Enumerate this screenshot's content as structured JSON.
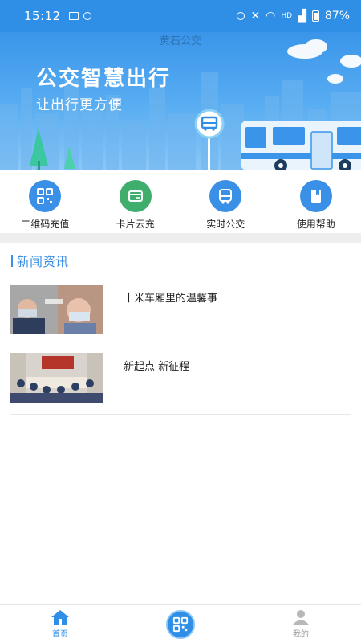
{
  "status_bar": {
    "time": "15:12",
    "network": "HD",
    "battery": "87%"
  },
  "banner": {
    "app_title": "黄石公交",
    "slogan_main": "公交智慧出行",
    "slogan_sub": "让出行更方便"
  },
  "quick_actions": [
    {
      "label": "二维码充值",
      "icon": "qr-code-icon",
      "color": "#3a8fe6"
    },
    {
      "label": "卡片云充",
      "icon": "card-icon",
      "color": "#3fae6c"
    },
    {
      "label": "实时公交",
      "icon": "bus-icon",
      "color": "#3a8fe6"
    },
    {
      "label": "使用帮助",
      "icon": "help-book-icon",
      "color": "#3a8fe6"
    }
  ],
  "news": {
    "section_title": "新闻资讯",
    "items": [
      {
        "title": "十米车厢里的温馨事"
      },
      {
        "title": "新起点 新征程"
      }
    ]
  },
  "bottom_nav": {
    "items": [
      {
        "label": "首页",
        "icon": "home-icon",
        "active": true
      },
      {
        "label": "",
        "icon": "qr-code-icon",
        "active": false
      },
      {
        "label": "我的",
        "icon": "user-icon",
        "active": false
      }
    ],
    "active_color": "#2f8fe6",
    "inactive_color": "#9a9a9a"
  }
}
